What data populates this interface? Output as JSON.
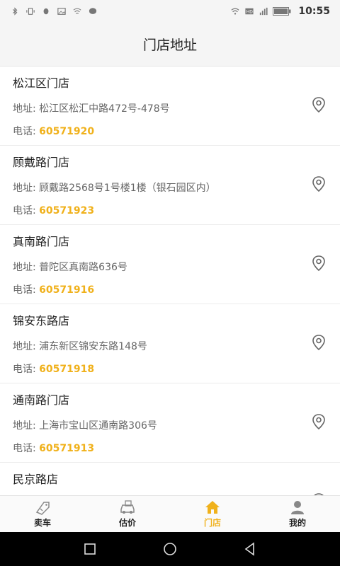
{
  "status_bar": {
    "time": "10:55",
    "left_icons": [
      "bluetooth-icon",
      "vibrate-icon",
      "qq-icon",
      "image-icon",
      "wifi-share-icon",
      "chat-icon"
    ],
    "right_icons": [
      "wifi-icon",
      "hd-icon",
      "signal-icon",
      "battery-icon"
    ]
  },
  "header": {
    "title": "门店地址"
  },
  "stores": [
    {
      "name": "松江区门店",
      "address_label": "地址: ",
      "address": "松江区松汇中路472号-478号",
      "phone_label": "电话: ",
      "phone": "60571920"
    },
    {
      "name": "顾戴路门店",
      "address_label": "地址: ",
      "address": "顾戴路2568号1号楼1楼（银石园区内）",
      "phone_label": "电话: ",
      "phone": "60571923"
    },
    {
      "name": "真南路门店",
      "address_label": "地址: ",
      "address": "普陀区真南路636号",
      "phone_label": "电话: ",
      "phone": "60571916"
    },
    {
      "name": "锦安东路店",
      "address_label": "地址: ",
      "address": "浦东新区锦安东路148号",
      "phone_label": "电话: ",
      "phone": "60571918"
    },
    {
      "name": "通南路门店",
      "address_label": "地址: ",
      "address": "上海市宝山区通南路306号",
      "phone_label": "电话: ",
      "phone": "60571913"
    },
    {
      "name": "民京路店",
      "address_label": "",
      "address": "",
      "phone_label": "",
      "phone": ""
    }
  ],
  "tabs": [
    {
      "label": "卖车",
      "icon": "sell-car-icon",
      "active": false
    },
    {
      "label": "估价",
      "icon": "appraisal-icon",
      "active": false
    },
    {
      "label": "门店",
      "icon": "home-icon",
      "active": true
    },
    {
      "label": "我的",
      "icon": "profile-icon",
      "active": false
    }
  ],
  "colors": {
    "accent": "#f0b11b",
    "header_bg": "#f5f5f5",
    "text_primary": "#222222",
    "text_secondary": "#666666"
  }
}
